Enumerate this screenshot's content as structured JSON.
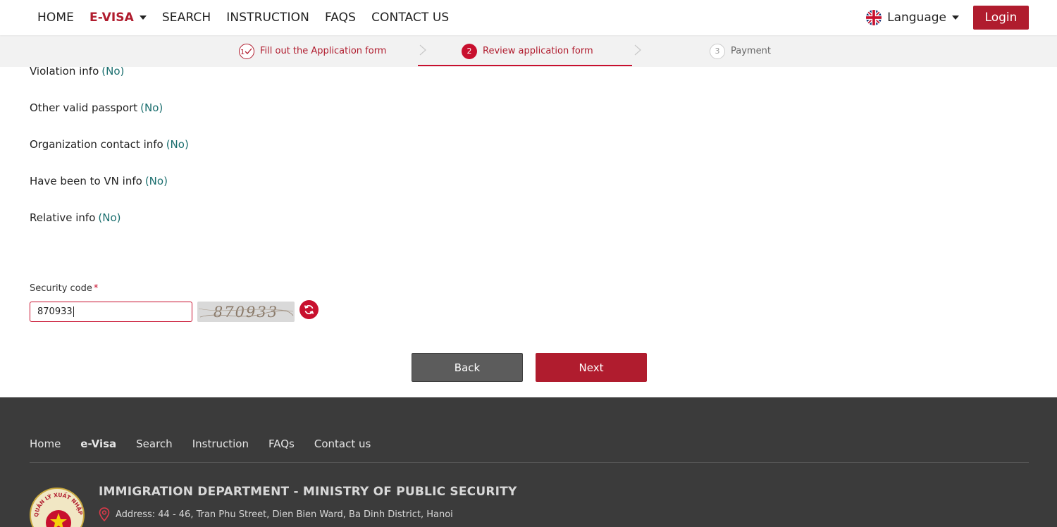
{
  "nav": {
    "items": [
      {
        "label": "HOME"
      },
      {
        "label": "E-VISA"
      },
      {
        "label": "SEARCH"
      },
      {
        "label": "INSTRUCTION"
      },
      {
        "label": "FAQS"
      },
      {
        "label": "CONTACT US"
      }
    ],
    "language_label": "Language",
    "login_label": "Login"
  },
  "steps": [
    {
      "number": "1",
      "label": "Fill out the Application form",
      "state": "completed"
    },
    {
      "number": "2",
      "label": "Review application form",
      "state": "active"
    },
    {
      "number": "3",
      "label": "Payment",
      "state": "pending"
    }
  ],
  "info_rows": [
    {
      "label": "Violation info",
      "value": "(No)"
    },
    {
      "label": "Other valid passport",
      "value": "(No)"
    },
    {
      "label": "Organization contact info",
      "value": "(No)"
    },
    {
      "label": "Have been to VN info",
      "value": "(No)"
    },
    {
      "label": "Relative info",
      "value": "(No)"
    }
  ],
  "security": {
    "label": "Security code",
    "required_mark": "*",
    "value": "870933",
    "captcha_text": "870933"
  },
  "buttons": {
    "back": "Back",
    "next": "Next"
  },
  "footer": {
    "links": [
      {
        "label": "Home"
      },
      {
        "label": "e-Visa"
      },
      {
        "label": "Search"
      },
      {
        "label": "Instruction"
      },
      {
        "label": "FAQs"
      },
      {
        "label": "Contact us"
      }
    ],
    "title": "IMMIGRATION DEPARTMENT - MINISTRY OF PUBLIC SECURITY",
    "address": "Address: 44 - 46, Tran Phu Street, Dien Bien Ward, Ba Dinh District, Hanoi",
    "emblem_text": "QUẢN LÝ XUẤT NHẬP CẢNH"
  },
  "colors": {
    "brand_red": "#b01c2e",
    "value_teal": "#1a6e6e",
    "footer_bg": "#3b3b3b"
  }
}
